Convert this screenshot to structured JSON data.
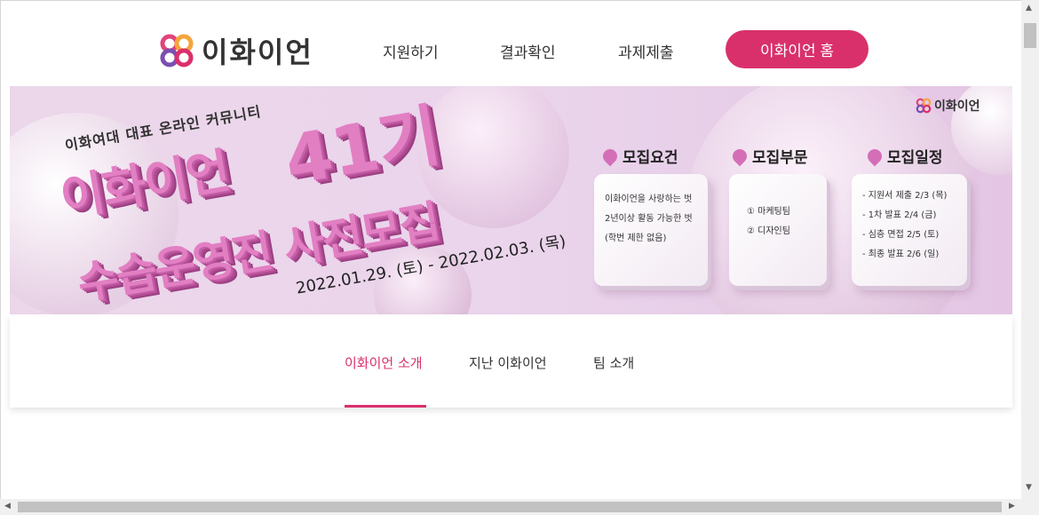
{
  "header": {
    "logo_text": "이화이언",
    "nav": [
      "지원하기",
      "결과확인",
      "과제제출"
    ],
    "home_button": "이화이언 홈"
  },
  "banner": {
    "subtitle": "이화여대 대표 온라인 커뮤니티",
    "headline_1": "이화이언",
    "headline_number": "41기",
    "headline_2": "수습운영진 사전모집",
    "date_range": "2022.01.29. (토) - 2022.02.03. (목)",
    "logo_text": "이화이언",
    "sections": [
      {
        "title": "모집요건",
        "lines": [
          "이화이언을 사랑하는 벗",
          "2년이상 활동 가능한 벗",
          "(학번 제한 없음)"
        ]
      },
      {
        "title": "모집부문",
        "lines": [
          "① 마케팅팀",
          "② 디자인팀"
        ]
      },
      {
        "title": "모집일정",
        "lines": [
          "- 지원서 제출  2/3 (목)",
          "- 1차 발표      2/4 (금)",
          "- 심층 면접    2/5 (토)",
          "- 최종 발표    2/6 (일)"
        ]
      }
    ]
  },
  "tabs": [
    "이화이언 소개",
    "지난 이화이언",
    "팀 소개"
  ],
  "colors": {
    "accent": "#d9306c",
    "banner_bg": "#ecd6ea",
    "headline": "#e27fc3"
  }
}
